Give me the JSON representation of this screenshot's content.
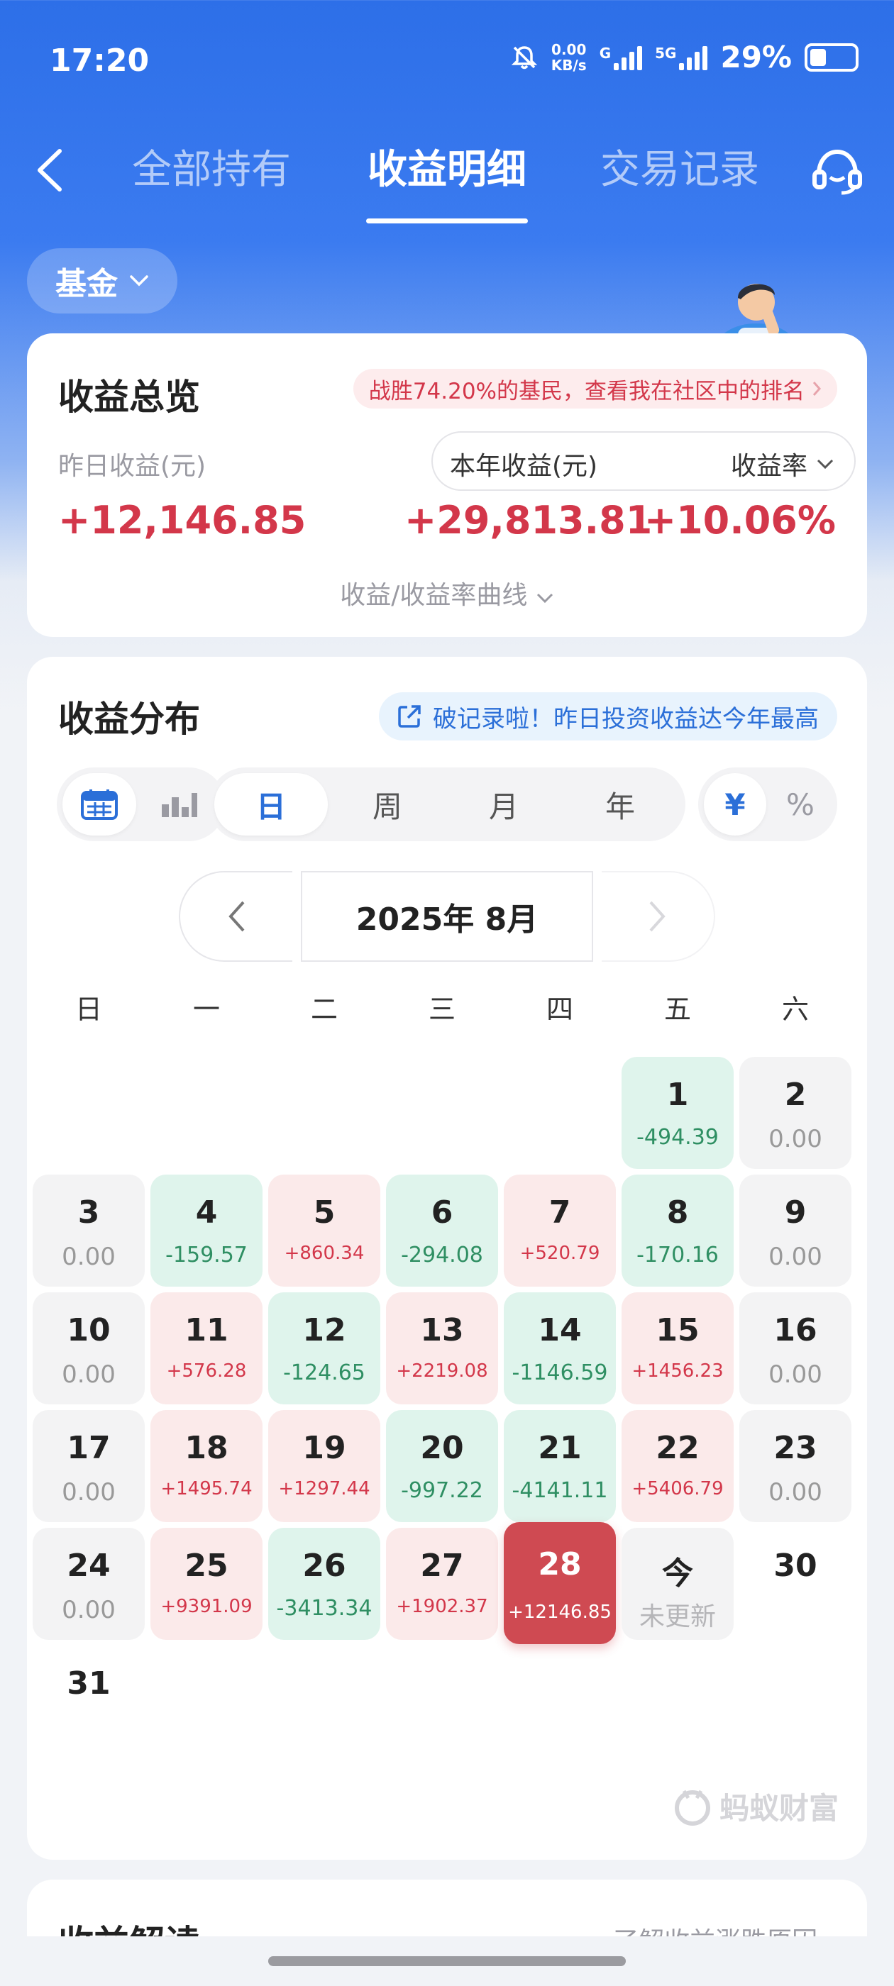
{
  "status_bar": {
    "time": "17:20",
    "speed_value": "0.00",
    "speed_unit": "KB/s",
    "net1": "G",
    "net2": "5G",
    "battery": "29%"
  },
  "nav": {
    "tabs": [
      "全部持有",
      "收益明细",
      "交易记录"
    ],
    "active_tab": "收益明细"
  },
  "filter": {
    "label": "基金"
  },
  "overview": {
    "title": "收益总览",
    "rank_banner": "战胜74.20%的基民，查看我在社区中的排名",
    "yesterday_label": "昨日收益(元)",
    "yesterday_value": "+12,146.85",
    "year_label": "本年收益(元)",
    "rate_selector": "收益率",
    "year_value": "+29,813.81",
    "rate_value": "+10.06%",
    "curve_link": "收益/收益率曲线"
  },
  "distribution": {
    "title": "收益分布",
    "record_banner": "破记录啦！昨日投资收益达今年最高",
    "periods": [
      "日",
      "周",
      "月",
      "年"
    ],
    "active_period": "日",
    "units": [
      "¥",
      "%"
    ],
    "active_unit": "¥",
    "month_label": "2025年 8月",
    "weekdays": [
      "日",
      "一",
      "二",
      "三",
      "四",
      "五",
      "六"
    ],
    "days": [
      {
        "day": "1",
        "value": "-494.39",
        "kind": "g"
      },
      {
        "day": "2",
        "value": "0.00",
        "kind": "z"
      },
      {
        "day": "3",
        "value": "0.00",
        "kind": "z"
      },
      {
        "day": "4",
        "value": "-159.57",
        "kind": "g"
      },
      {
        "day": "5",
        "value": "+860.34",
        "kind": "r"
      },
      {
        "day": "6",
        "value": "-294.08",
        "kind": "g"
      },
      {
        "day": "7",
        "value": "+520.79",
        "kind": "r"
      },
      {
        "day": "8",
        "value": "-170.16",
        "kind": "g"
      },
      {
        "day": "9",
        "value": "0.00",
        "kind": "z"
      },
      {
        "day": "10",
        "value": "0.00",
        "kind": "z"
      },
      {
        "day": "11",
        "value": "+576.28",
        "kind": "r"
      },
      {
        "day": "12",
        "value": "-124.65",
        "kind": "g"
      },
      {
        "day": "13",
        "value": "+2219.08",
        "kind": "r"
      },
      {
        "day": "14",
        "value": "-1146.59",
        "kind": "g"
      },
      {
        "day": "15",
        "value": "+1456.23",
        "kind": "r"
      },
      {
        "day": "16",
        "value": "0.00",
        "kind": "z"
      },
      {
        "day": "17",
        "value": "0.00",
        "kind": "z"
      },
      {
        "day": "18",
        "value": "+1495.74",
        "kind": "r"
      },
      {
        "day": "19",
        "value": "+1297.44",
        "kind": "r"
      },
      {
        "day": "20",
        "value": "-997.22",
        "kind": "g"
      },
      {
        "day": "21",
        "value": "-4141.11",
        "kind": "g"
      },
      {
        "day": "22",
        "value": "+5406.79",
        "kind": "r"
      },
      {
        "day": "23",
        "value": "0.00",
        "kind": "z"
      },
      {
        "day": "24",
        "value": "0.00",
        "kind": "z"
      },
      {
        "day": "25",
        "value": "+9391.09",
        "kind": "r"
      },
      {
        "day": "26",
        "value": "-3413.34",
        "kind": "g"
      },
      {
        "day": "27",
        "value": "+1902.37",
        "kind": "r"
      },
      {
        "day": "28",
        "value": "+12146.85",
        "kind": "sel"
      },
      {
        "day": "今",
        "value": "未更新",
        "kind": "today"
      },
      {
        "day": "30",
        "value": "",
        "kind": "empty"
      },
      {
        "day": "31",
        "value": "",
        "kind": "empty"
      }
    ],
    "watermark": "蚂蚁财富"
  },
  "interpretation": {
    "title": "收益解读",
    "link": "了解收益涨跌原因"
  },
  "colors": {
    "brand_blue": "#2d6fe8",
    "gain_red": "#d3374a",
    "loss_green": "#2f8f63",
    "selected_red": "#cf4a52"
  }
}
